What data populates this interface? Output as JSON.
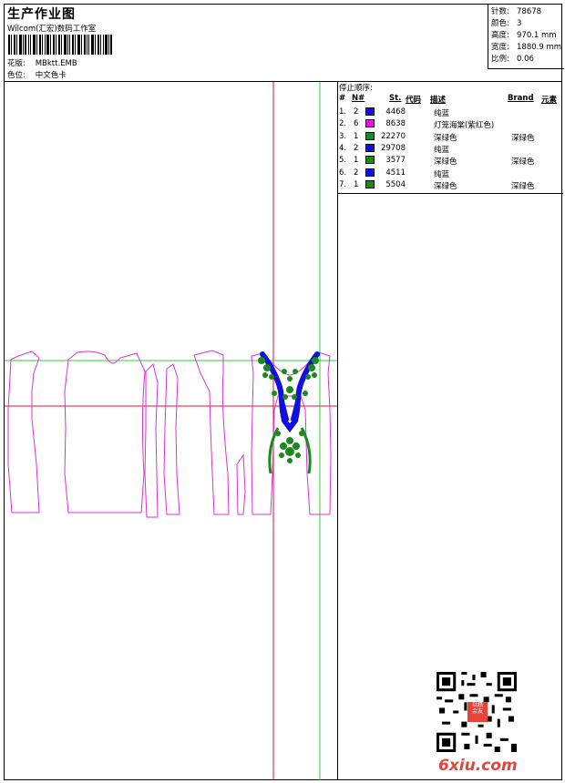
{
  "header": {
    "title": "生产作业图",
    "company": "Wilcom(汇宏)数码工作室",
    "pattern_label": "花版:",
    "pattern_value": "MBktt.EMB",
    "colorway_label": "色位:",
    "colorway_value": "中文色卡"
  },
  "stats": [
    {
      "label": "针数:",
      "value": "78678"
    },
    {
      "label": "颜色:",
      "value": "3"
    },
    {
      "label": "高度:",
      "value": "970.1 mm"
    },
    {
      "label": "宽度:",
      "value": "1880.9 mm"
    },
    {
      "label": "比例:",
      "value": "0.06"
    }
  ],
  "sequence": {
    "title": "停止顺序:",
    "columns": {
      "num": "#",
      "n": "N#",
      "st": "St.",
      "code": "代码",
      "desc": "描述",
      "brand": "Brand",
      "elem": "元素"
    },
    "rows": [
      {
        "num": "1.",
        "n": "2",
        "color": "#1010e0",
        "st": "4468",
        "desc": "纯蓝",
        "brand": ""
      },
      {
        "num": "2.",
        "n": "6",
        "color": "#ee10ee",
        "st": "8638",
        "desc": "灯笼海棠(紫红色)",
        "brand": ""
      },
      {
        "num": "3.",
        "n": "1",
        "color": "#1a8a1a",
        "st": "22270",
        "desc": "深绿色",
        "brand": "深绿色"
      },
      {
        "num": "4.",
        "n": "2",
        "color": "#1010e0",
        "st": "29708",
        "desc": "纯蓝",
        "brand": ""
      },
      {
        "num": "5.",
        "n": "1",
        "color": "#1a8a1a",
        "st": "3577",
        "desc": "深绿色",
        "brand": "深绿色"
      },
      {
        "num": "6.",
        "n": "2",
        "color": "#1010e0",
        "st": "4511",
        "desc": "纯蓝",
        "brand": ""
      },
      {
        "num": "7.",
        "n": "1",
        "color": "#1a8a1a",
        "st": "5504",
        "desc": "深绿色",
        "brand": "深绿色"
      }
    ]
  },
  "watermark": {
    "site": "6xiu.com",
    "stamp": "以绣会友"
  },
  "colors": {
    "outline": "#d633d6",
    "crosshair_red": "#e0103a",
    "crosshair_green": "#33cc33",
    "blue": "#1010e0",
    "green": "#1a8a1a",
    "watermark": "#e9423b"
  }
}
